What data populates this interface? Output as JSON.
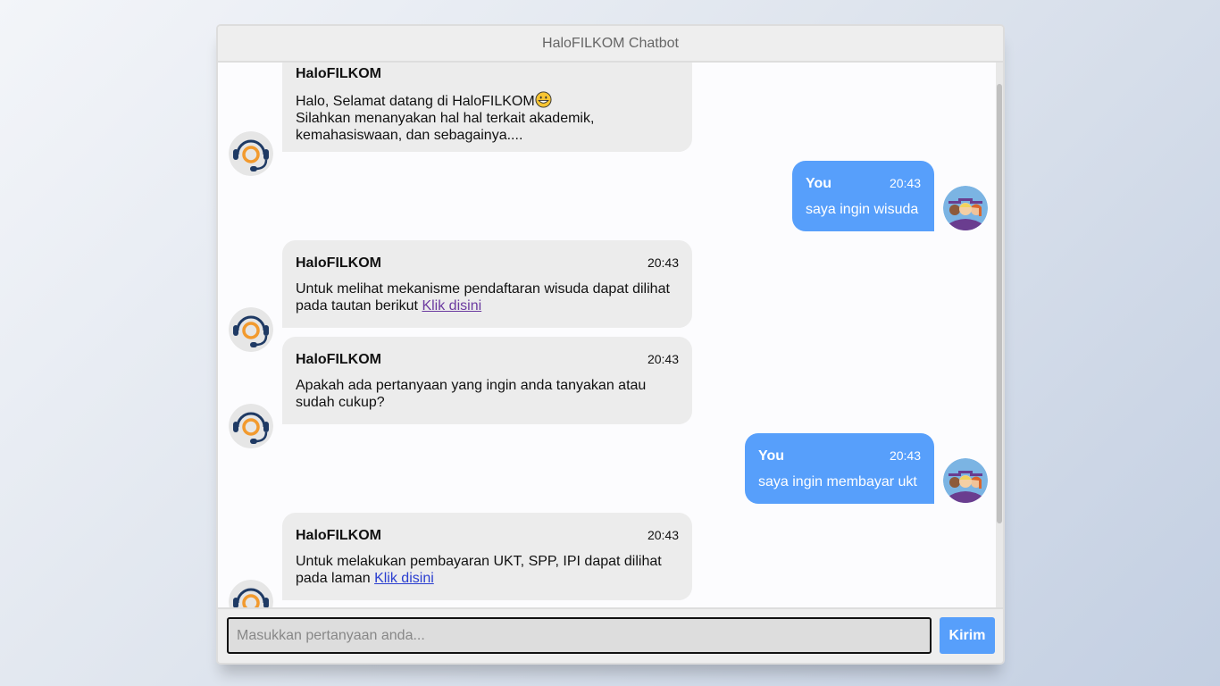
{
  "header": {
    "title": "HaloFILKOM Chatbot"
  },
  "bot": {
    "name": "HaloFILKOM",
    "avatar_icon": "headset-icon"
  },
  "user": {
    "name": "You",
    "avatar_icon": "graduates-avatar-icon"
  },
  "messages": [
    {
      "sender": "bot",
      "name": "HaloFILKOM",
      "time": "",
      "text": "Halo, Selamat datang di HaloFILKOM",
      "emoji": "grinning-face-emoji",
      "text2": "Silahkan menanyakan hal hal terkait akademik, kemahasiswaan, dan sebagainya...."
    },
    {
      "sender": "user",
      "name": "You",
      "time": "20:43",
      "text": "saya ingin wisuda"
    },
    {
      "sender": "bot",
      "name": "HaloFILKOM",
      "time": "20:43",
      "text": "Untuk melihat mekanisme pendaftaran wisuda dapat dilihat pada tautan berikut",
      "link": "Klik disini"
    },
    {
      "sender": "bot",
      "name": "HaloFILKOM",
      "time": "20:43",
      "text": "Apakah ada pertanyaan yang ingin anda tanyakan atau sudah cukup?"
    },
    {
      "sender": "user",
      "name": "You",
      "time": "20:43",
      "text": "saya ingin membayar ukt"
    },
    {
      "sender": "bot",
      "name": "HaloFILKOM",
      "time": "20:43",
      "text": "Untuk melakukan pembayaran UKT, SPP, IPI dapat dilihat pada laman",
      "link": "Klik disini"
    }
  ],
  "input": {
    "placeholder": "Masukkan pertanyaan anda...",
    "value": ""
  },
  "send_button": {
    "label": "Kirim"
  },
  "colors": {
    "accent": "#579ffb",
    "bot_bubble": "#ececec",
    "header_bg": "#eeeeee"
  }
}
